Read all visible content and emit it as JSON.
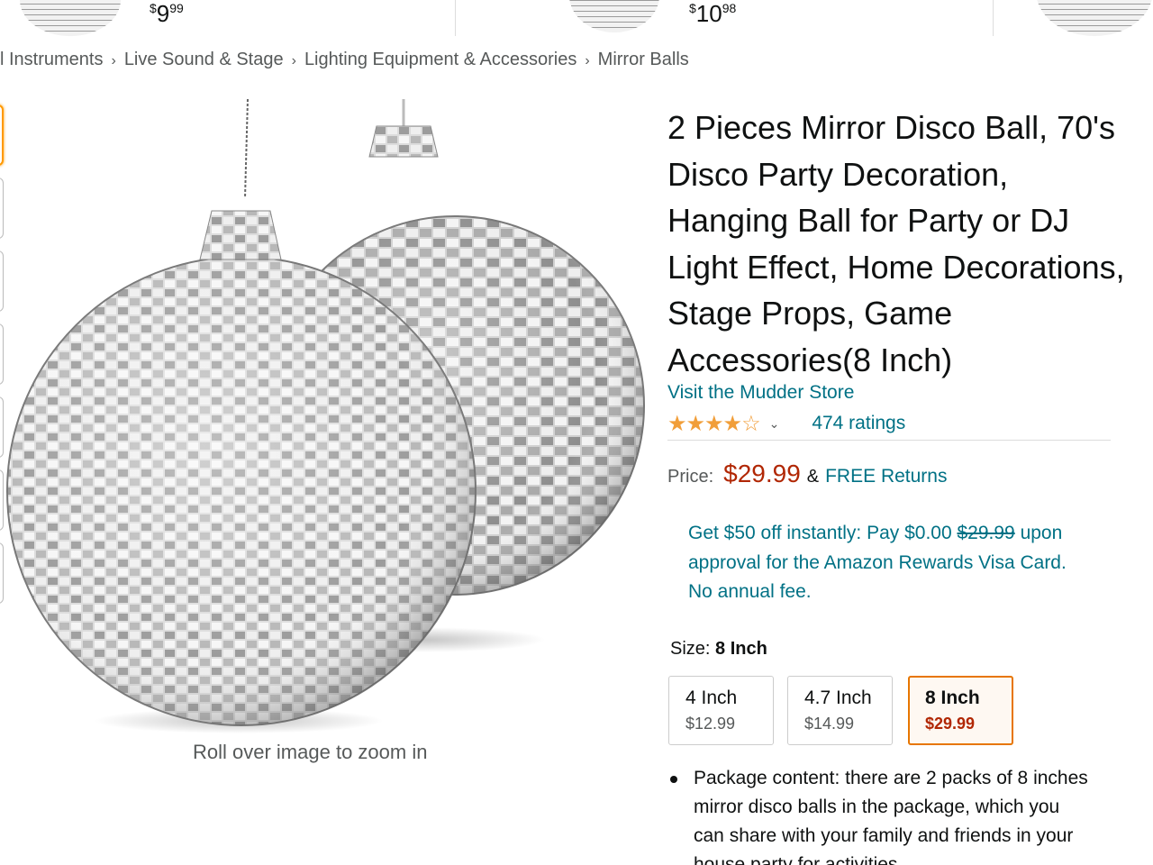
{
  "carousel": {
    "items": [
      {
        "currency": "$",
        "whole": "9",
        "fraction": "99"
      },
      {
        "currency": "$",
        "whole": "10",
        "fraction": "98"
      }
    ]
  },
  "breadcrumb": {
    "items": [
      "l Instruments",
      "Live Sound & Stage",
      "Lighting Equipment & Accessories",
      "Mirror Balls"
    ],
    "separator": "›"
  },
  "gallery": {
    "zoom_hint": "Roll over image to zoom in"
  },
  "product": {
    "title": "2 Pieces Mirror Disco Ball, 70's Disco Party Decoration, Hanging Ball for Party or DJ Light Effect, Home Decorations, Stage Props, Game Accessories(8 Inch)",
    "store_link": "Visit the Mudder Store",
    "rating_stars": 4.0,
    "ratings_count": "474 ratings",
    "price_label": "Price:",
    "price": "$29.99",
    "amp": "&",
    "free_returns": "FREE Returns",
    "promo": {
      "prefix": "Get $50 off instantly: Pay $0.00",
      "strike_price": "$29.99",
      "suffix": "upon approval for the Amazon Rewards Visa Card. No annual fee."
    },
    "size_label": "Size:",
    "size_selected": "8 Inch",
    "sizes": [
      {
        "name": "4 Inch",
        "price": "$12.99"
      },
      {
        "name": "4.7 Inch",
        "price": "$14.99"
      },
      {
        "name": "8 Inch",
        "price": "$29.99"
      }
    ],
    "bullets": [
      "Package content: there are 2 packs of 8 inches mirror disco balls in the package, which you can share with your family and friends in your house party for activities"
    ]
  },
  "colors": {
    "link": "#007185",
    "price": "#b12704",
    "star": "#f19e39",
    "selected_border": "#e77600"
  }
}
